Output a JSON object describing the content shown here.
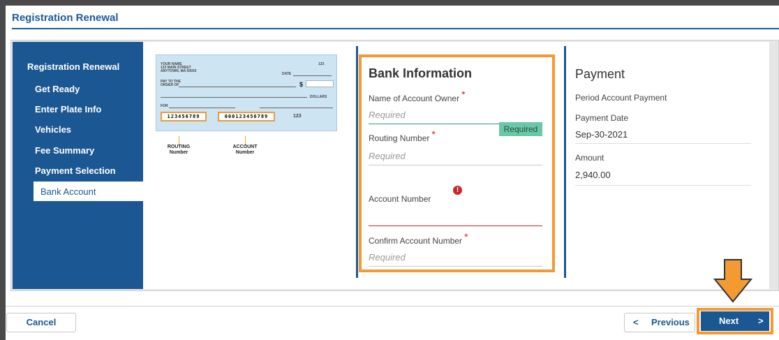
{
  "header": {
    "title": "Registration Renewal"
  },
  "sidebar": {
    "heading": "Registration Renewal",
    "items": [
      {
        "label": "Get Ready"
      },
      {
        "label": "Enter Plate Info"
      },
      {
        "label": "Vehicles"
      },
      {
        "label": "Fee Summary"
      },
      {
        "label": "Payment Selection"
      },
      {
        "label": "Bank Account",
        "active": true
      }
    ]
  },
  "check": {
    "name": "YOUR NAME",
    "street": "123 MAIN STREET",
    "city": "ANYTOWN, MA 00003",
    "number": "123",
    "date_label": "DATE",
    "pay_to": "PAY TO THE",
    "order_of": "ORDER OF",
    "dollar_sign": "$",
    "dollars": "DOLLARS",
    "for_label": "FOR",
    "routing_digits": "123456789",
    "account_digits": "000123456789",
    "check_digits": "123",
    "routing_label_1": "ROUTING",
    "routing_label_2": "Number",
    "account_label_1": "ACCOUNT",
    "account_label_2": "Number"
  },
  "bank_info": {
    "title": "Bank Information",
    "owner_label": "Name of Account Owner",
    "owner_placeholder": "Required",
    "routing_label": "Routing Number",
    "routing_placeholder": "Required",
    "routing_tag": "Required",
    "account_label": "Account Number",
    "confirm_label": "Confirm Account Number",
    "confirm_placeholder": "Required",
    "required_mark": "*",
    "error_mark": "!"
  },
  "payment": {
    "title": "Payment",
    "period_label": "Period Account Payment",
    "date_label": "Payment Date",
    "date_value": "Sep-30-2021",
    "amount_label": "Amount",
    "amount_value": "2,940.00"
  },
  "footer": {
    "cancel": "Cancel",
    "previous": "Previous",
    "next": "Next",
    "prev_chevron": "<",
    "next_chevron": ">"
  },
  "colors": {
    "brand_blue": "#1b5792",
    "highlight_orange": "#f39a33",
    "required_red": "#d31f1f",
    "tag_green": "#6ac8a6"
  }
}
